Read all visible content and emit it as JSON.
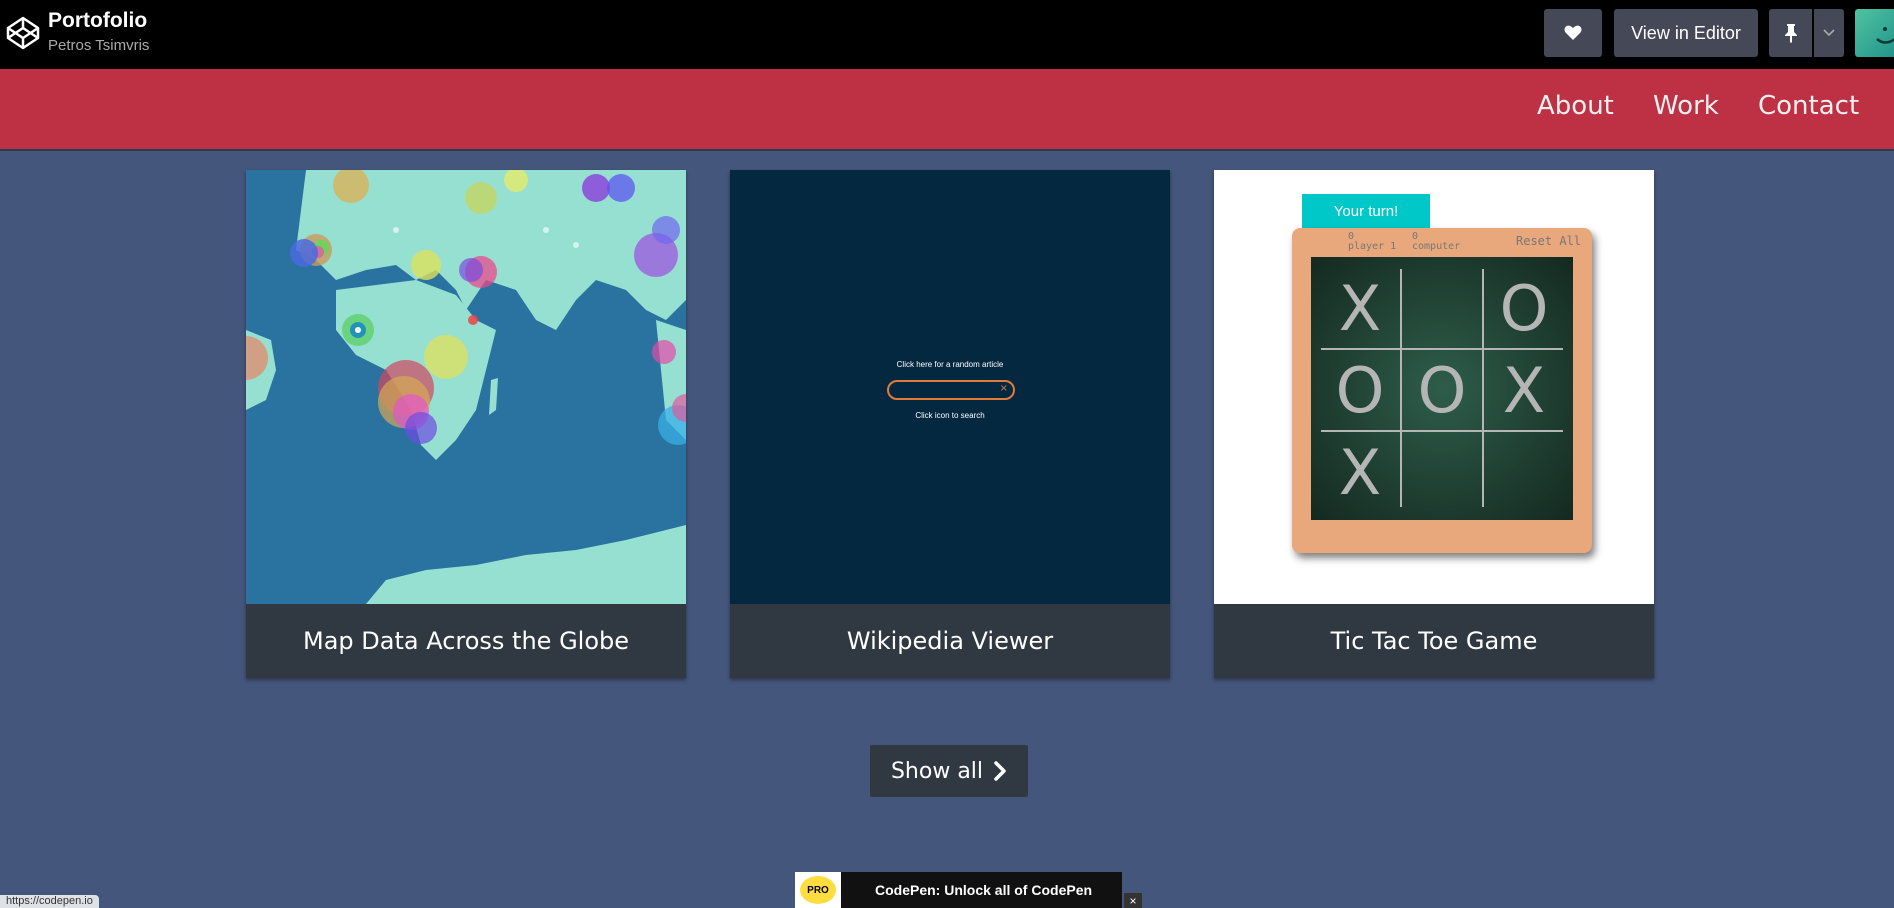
{
  "codepen": {
    "title": "Portofolio",
    "author": "Petros Tsimvris",
    "view_in_editor": "View in Editor",
    "icons": [
      "codepen-logo-icon",
      "heart-icon",
      "pin-icon",
      "chevron-down-icon"
    ]
  },
  "nav": {
    "links": [
      "About",
      "Work",
      "Contact"
    ]
  },
  "projects": [
    {
      "title": "Map Data Across the Globe"
    },
    {
      "title": "Wikipedia Viewer",
      "random_text": "Click here for a random article",
      "search_hint": "Click icon to search"
    },
    {
      "title": "Tic Tac Toe Game",
      "turn": "Your turn!",
      "player_score": "0",
      "player_label": "player 1",
      "computer_score": "0",
      "computer_label": "computer",
      "reset": "Reset All",
      "board": [
        "X",
        "",
        "O",
        "O",
        "O",
        "X",
        "X",
        "",
        ""
      ]
    }
  ],
  "show_all": "Show all",
  "pro_banner": "CodePen: Unlock all of CodePen",
  "pro_badge": "PRO",
  "close_symbol": "×",
  "status_url": "https://codepen.io",
  "colors": {
    "nav_red": "#be3144",
    "page_bg": "#45567d",
    "card_footer": "#303841",
    "ttt_turn": "#00c8c8"
  }
}
